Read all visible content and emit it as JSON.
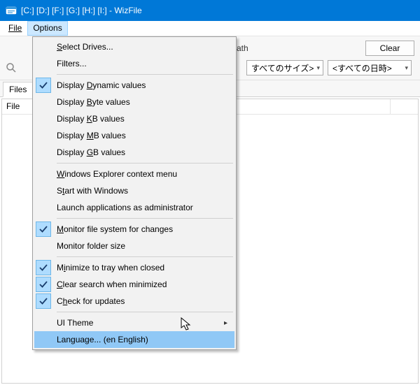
{
  "window": {
    "title": "[C:] [D:] [F:] [G:] [H:] [I:]  - WizFile"
  },
  "menubar": {
    "file": "File",
    "options": "Options"
  },
  "toolbar": {
    "path_label": "ath",
    "clear_label": "Clear",
    "size_combo": "すべてのサイズ>",
    "date_combo": "<すべての日時>"
  },
  "tabs": {
    "files": "Files"
  },
  "table": {
    "header_name": "File"
  },
  "options_menu": {
    "select_drives": {
      "label": "Select Drives...",
      "checked": false,
      "underline_index": 0
    },
    "filters": {
      "label": "Filters...",
      "checked": false,
      "underline_index": null
    },
    "display_dynamic": {
      "label": "Display Dynamic values",
      "checked": true,
      "underline_index": 8
    },
    "display_byte": {
      "label": "Display Byte values",
      "checked": false,
      "underline_index": 8
    },
    "display_kb": {
      "label": "Display KB values",
      "checked": false,
      "underline_index": 8
    },
    "display_mb": {
      "label": "Display MB values",
      "checked": false,
      "underline_index": 8
    },
    "display_gb": {
      "label": "Display GB values",
      "checked": false,
      "underline_index": 8
    },
    "explorer_context": {
      "label": "Windows Explorer context menu",
      "checked": false,
      "underline_index": 0
    },
    "start_with_windows": {
      "label": "Start with Windows",
      "checked": false,
      "underline_index": 1
    },
    "launch_admin": {
      "label": "Launch applications as administrator",
      "checked": false,
      "underline_index": null
    },
    "monitor_fs": {
      "label": "Monitor file system for changes",
      "checked": true,
      "underline_index": 0
    },
    "monitor_folder": {
      "label": "Monitor folder size",
      "checked": false,
      "underline_index": null
    },
    "minimize_tray": {
      "label": "Minimize to tray when closed",
      "checked": true,
      "underline_index": 1
    },
    "clear_search": {
      "label": "Clear search when minimized",
      "checked": true,
      "underline_index": 0
    },
    "check_updates": {
      "label": "Check for updates",
      "checked": true,
      "underline_index": 1
    },
    "ui_theme": {
      "label": "UI Theme",
      "checked": false,
      "submenu": true
    },
    "language": {
      "label": "Language... (en English)",
      "checked": false,
      "highlighted": true
    }
  }
}
